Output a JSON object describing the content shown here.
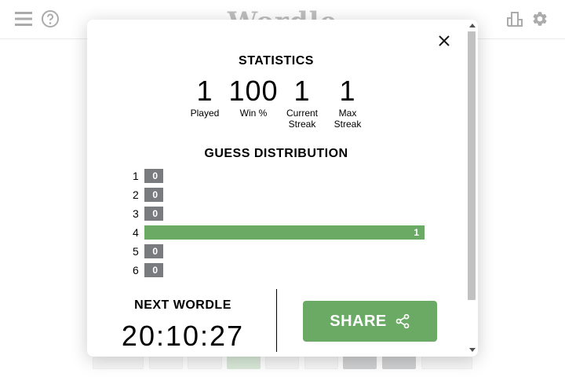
{
  "header": {
    "title": "Wordle",
    "icons": [
      "menu-icon",
      "help-icon",
      "stats-icon",
      "gear-icon"
    ]
  },
  "modal": {
    "statistics_heading": "STATISTICS",
    "stats": [
      {
        "value": "1",
        "label": "Played"
      },
      {
        "value": "100",
        "label": "Win %"
      },
      {
        "value": "1",
        "label": "Current Streak"
      },
      {
        "value": "1",
        "label": "Max Streak"
      }
    ],
    "distribution_heading": "GUESS DISTRIBUTION",
    "distribution": [
      {
        "guess": "1",
        "count": "0"
      },
      {
        "guess": "2",
        "count": "0"
      },
      {
        "guess": "3",
        "count": "0"
      },
      {
        "guess": "4",
        "count": "1"
      },
      {
        "guess": "5",
        "count": "0"
      },
      {
        "guess": "6",
        "count": "0"
      }
    ],
    "next_heading": "NEXT WORDLE",
    "timer": "20:10:27",
    "share_label": "SHARE"
  },
  "colors": {
    "correct": "#6aaa64",
    "absent": "#787c7e",
    "title_gray": "#7d7d7d"
  }
}
